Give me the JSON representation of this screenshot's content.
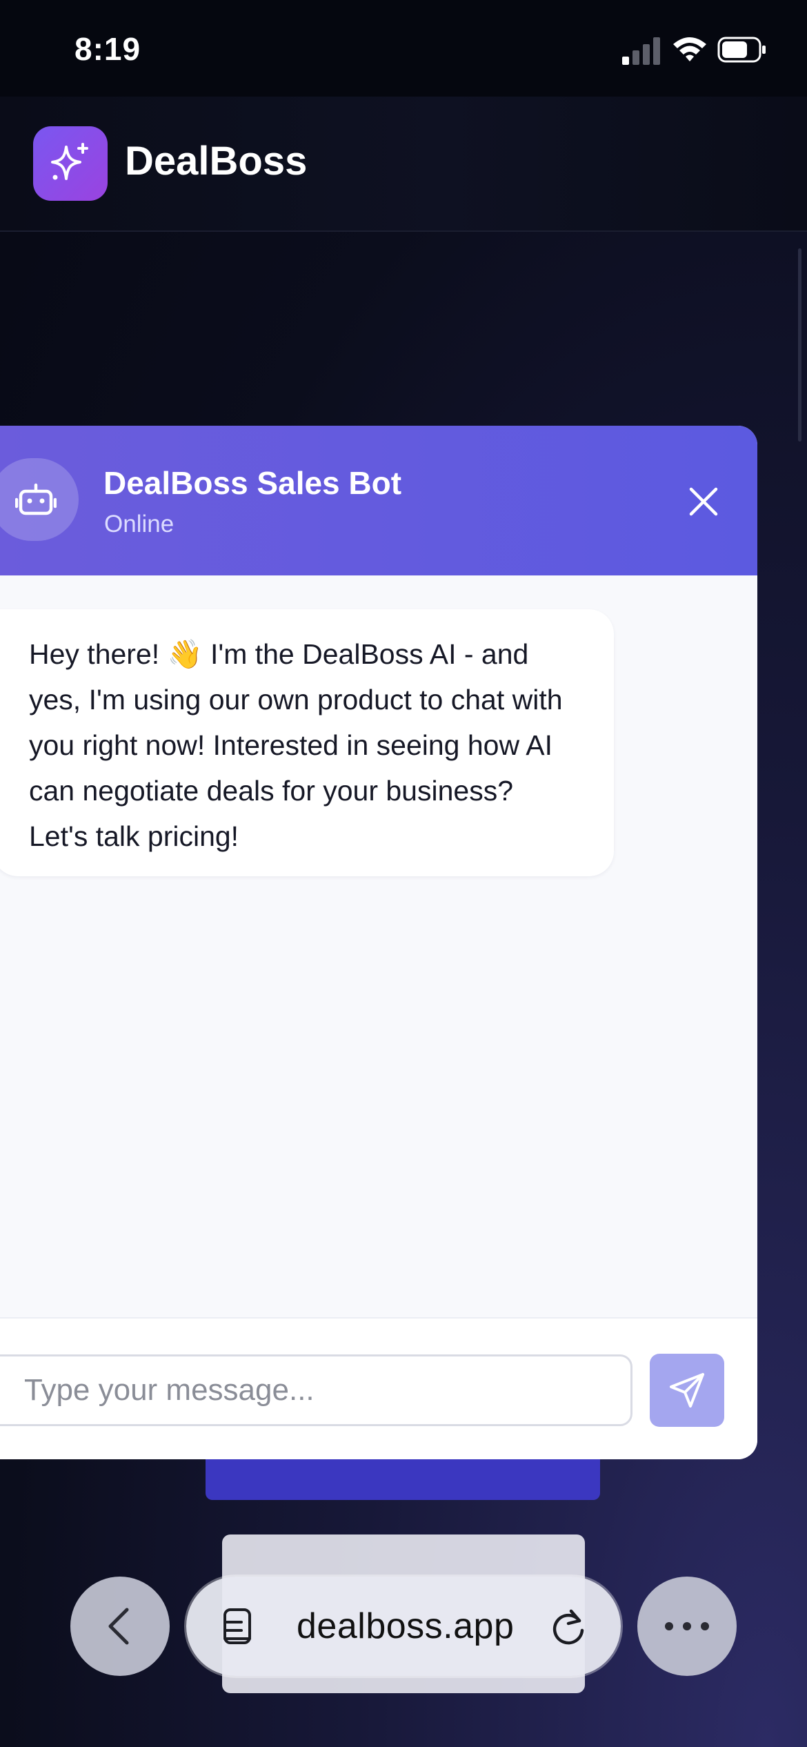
{
  "status_bar": {
    "time": "8:19",
    "icons": [
      "signal-icon",
      "wifi-icon",
      "battery-icon"
    ]
  },
  "app": {
    "brand_name": "DealBoss",
    "logo_icon": "sparkles-icon",
    "logo_colors": [
      "#7a57f0",
      "#9a43e0"
    ]
  },
  "chat": {
    "bot_name": "DealBoss Sales Bot",
    "bot_status": "Online",
    "avatar_icon": "robot-icon",
    "close_icon": "close-icon",
    "header_color": "#6360de",
    "messages": [
      {
        "sender": "bot",
        "text": "Hey there! 👋 I'm the DealBoss AI - and yes, I'm using our own product to chat with you right now! Interested in seeing how AI can negotiate deals for your business? Let's talk pricing!"
      }
    ],
    "input": {
      "placeholder": "Type your message...",
      "value": ""
    },
    "send_icon": "send-icon",
    "send_button_color": "#a4a6ef"
  },
  "browser": {
    "url": "dealboss.app",
    "back_icon": "chevron-left-icon",
    "tabs_icon": "tabs-icon",
    "reload_icon": "reload-icon",
    "more_icon": "more-icon"
  }
}
